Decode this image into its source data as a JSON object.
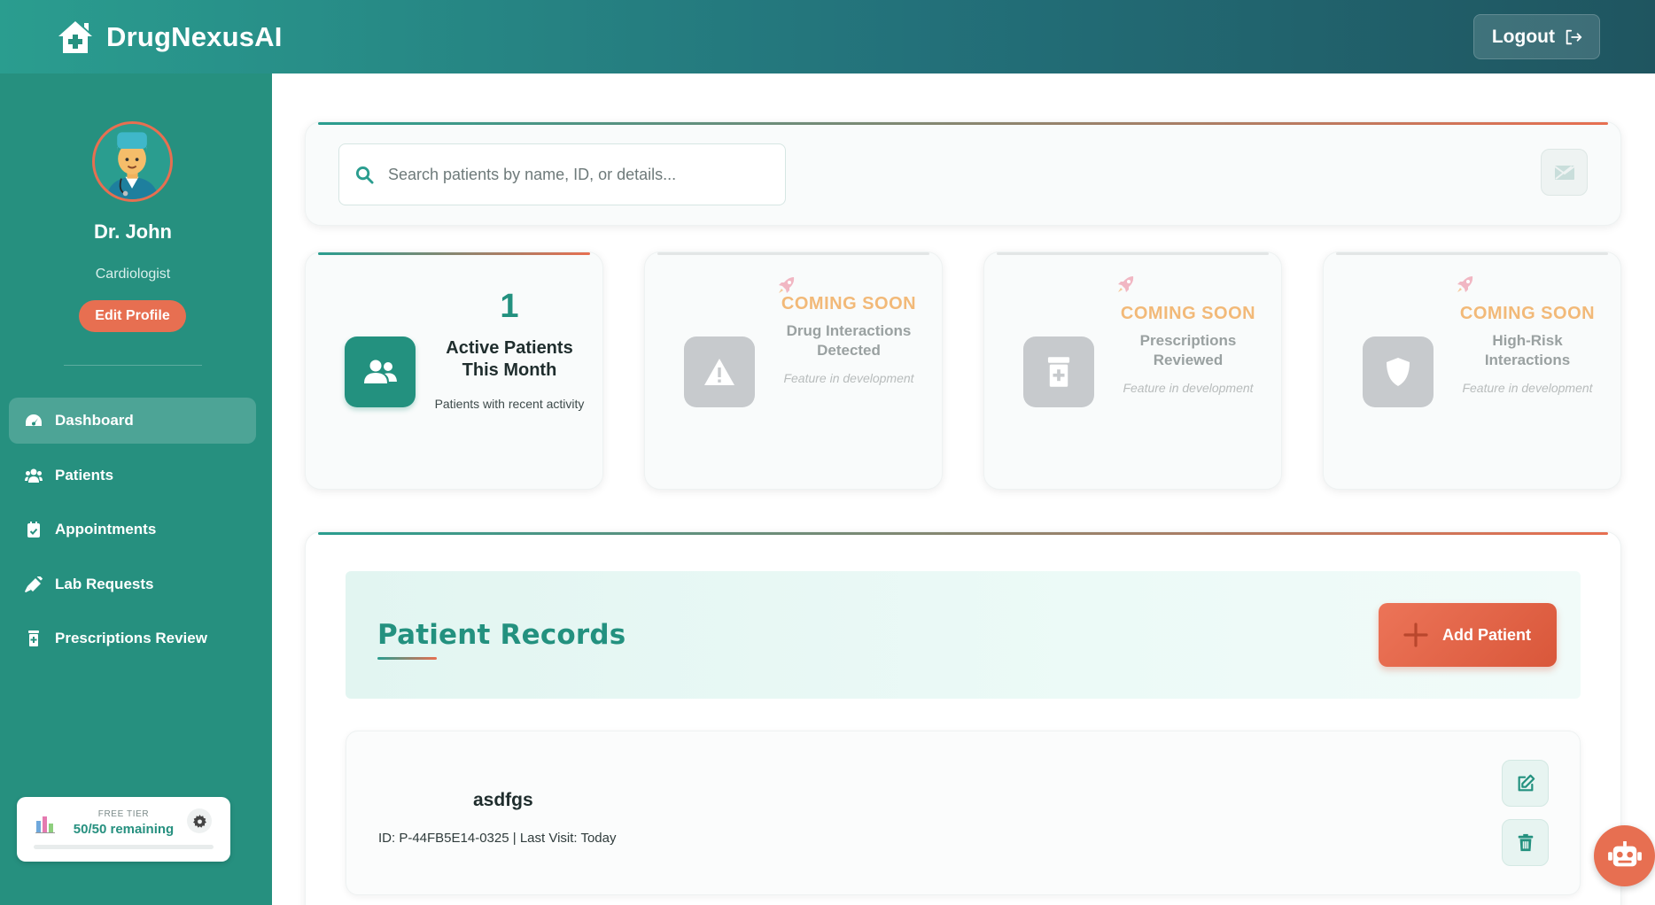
{
  "header": {
    "brand_icon": "house-medical-icon",
    "brand_name": "DrugNexusAI",
    "logout_label": "Logout",
    "logout_icon": "logout-icon"
  },
  "colors": {
    "primary": "#2a9d8f",
    "sidebar": "#26907f",
    "accent": "#e76f51",
    "coming_soon": "#f2b978"
  },
  "profile": {
    "name": "Dr. John",
    "role": "Cardiologist",
    "edit_label": "Edit Profile"
  },
  "sidebar": {
    "items": [
      {
        "label": "Dashboard",
        "icon": "gauge-icon",
        "active": true
      },
      {
        "label": "Patients",
        "icon": "users-icon",
        "active": false
      },
      {
        "label": "Appointments",
        "icon": "calendar-check-icon",
        "active": false
      },
      {
        "label": "Lab Requests",
        "icon": "syringe-icon",
        "active": false
      },
      {
        "label": "Prescriptions Review",
        "icon": "prescription-bottle-icon",
        "active": false
      }
    ]
  },
  "tier": {
    "label": "FREE TIER",
    "remaining": "50/50 remaining",
    "used_fraction": 0
  },
  "search": {
    "placeholder": "Search patients by name, ID, or details..."
  },
  "stats": {
    "active": {
      "number": "1",
      "title": "Active Patients This Month",
      "desc": "Patients with recent activity",
      "icon": "users-icon"
    },
    "drug": {
      "badge": "COMING SOON",
      "title": "Drug Interactions Detected",
      "note": "Feature in development",
      "icon": "warning-icon"
    },
    "rx": {
      "badge": "COMING SOON",
      "title": "Prescriptions Reviewed",
      "note": "Feature in development",
      "icon": "prescription-bottle-icon"
    },
    "risk": {
      "badge": "COMING SOON",
      "title": "High-Risk Interactions",
      "note": "Feature in development",
      "icon": "shield-icon"
    }
  },
  "records": {
    "title": "Patient Records",
    "add_label": "Add Patient",
    "patients": [
      {
        "name": "asdfgs",
        "meta": "ID: P-44FB5E14-0325 | Last Visit: Today"
      }
    ]
  }
}
